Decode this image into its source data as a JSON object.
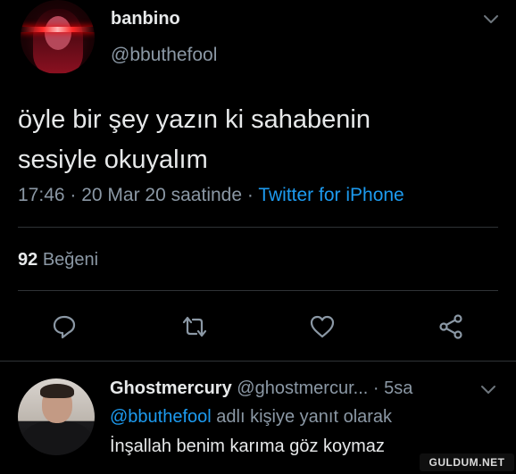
{
  "tweet": {
    "display_name": "banbino",
    "handle": "@bbuthefool",
    "text_line1": "öyle bir şey yazın ki sahabenin",
    "text_line2": "sesiyle okuyalım",
    "meta": {
      "time": "17:46",
      "sep1": " · ",
      "date": "20 Mar 20 saatinde",
      "sep2": " · ",
      "source": "Twitter for iPhone"
    },
    "likes": {
      "count": "92",
      "label": "Beğeni"
    }
  },
  "actions": {
    "reply_icon": "reply-icon",
    "retweet_icon": "retweet-icon",
    "like_icon": "heart-icon",
    "share_icon": "share-icon"
  },
  "reply": {
    "display_name": "Ghostmercury",
    "handle": "@ghostmercur...",
    "time": "· 5sa",
    "replying_to_mention": "@bbuthefool",
    "replying_to_suffix": "adlı kişiye yanıt olarak",
    "text": "İnşallah benim karıma göz koymaz"
  },
  "watermark": "GULDUM.NET",
  "colors": {
    "background": "#000000",
    "primary_text": "#e7e9ea",
    "secondary_text": "#8b98a5",
    "link": "#1d9bf0",
    "divider": "#2f3336"
  }
}
